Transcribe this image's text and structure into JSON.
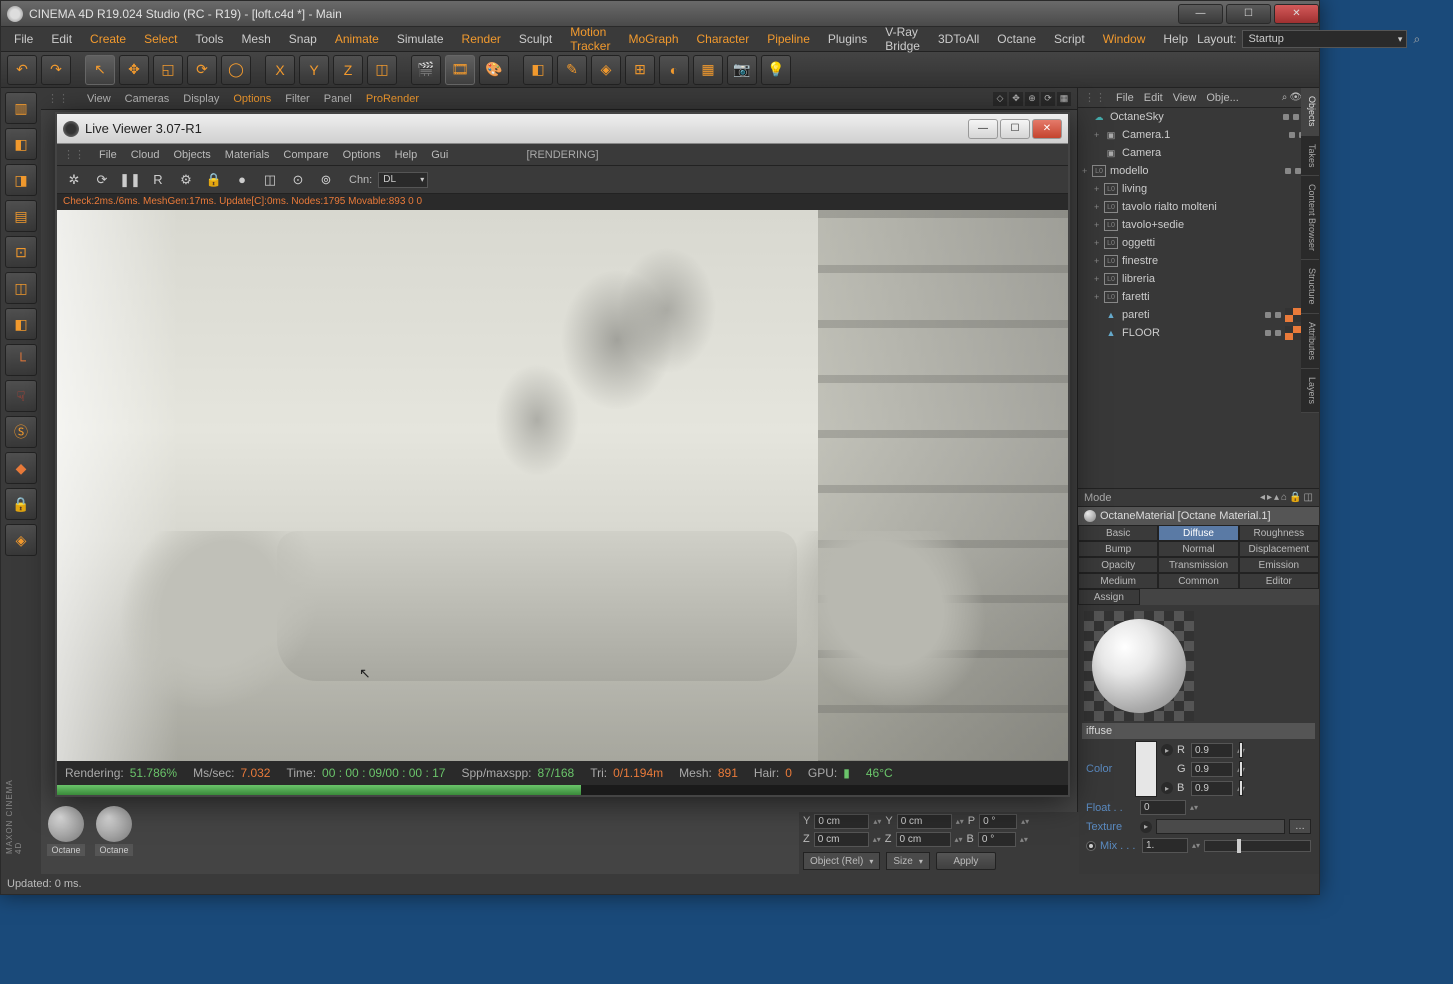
{
  "window": {
    "title": "CINEMA 4D R19.024 Studio (RC - R19) - [loft.c4d *] - Main"
  },
  "main_menu": [
    "File",
    "Edit",
    "Create",
    "Select",
    "Tools",
    "Mesh",
    "Snap",
    "Animate",
    "Simulate",
    "Render",
    "Sculpt",
    "Motion Tracker",
    "MoGraph",
    "Character",
    "Pipeline",
    "Plugins",
    "V-Ray Bridge",
    "3DToAll",
    "Octane",
    "Script",
    "Window",
    "Help"
  ],
  "layout": {
    "label": "Layout:",
    "value": "Startup"
  },
  "viewport_menu": [
    "View",
    "Cameras",
    "Display",
    "Options",
    "Filter",
    "Panel",
    "ProRender"
  ],
  "objects_panel": {
    "menu": [
      "File",
      "Edit",
      "View",
      "Obje..."
    ],
    "tree": [
      {
        "label": "OctaneSky",
        "icon": "sky",
        "tags": [
          "octane"
        ]
      },
      {
        "label": "Camera.1",
        "icon": "cam",
        "tags": [
          "rec"
        ],
        "indent": 1,
        "expand": "+"
      },
      {
        "label": "Camera",
        "icon": "cam",
        "tags": [],
        "indent": 1
      },
      {
        "label": "modello",
        "icon": "null",
        "tags": [
          "sphere"
        ],
        "expand": "+"
      },
      {
        "label": "living",
        "icon": "null",
        "tags": [],
        "indent": 1,
        "expand": "+"
      },
      {
        "label": "tavolo rialto molteni",
        "icon": "null",
        "tags": [],
        "indent": 1,
        "expand": "+"
      },
      {
        "label": "tavolo+sedie",
        "icon": "null",
        "tags": [],
        "indent": 1,
        "expand": "+"
      },
      {
        "label": "oggetti",
        "icon": "null",
        "tags": [],
        "indent": 1,
        "expand": "+"
      },
      {
        "label": "finestre",
        "icon": "null",
        "tags": [],
        "indent": 1,
        "expand": "+"
      },
      {
        "label": "libreria",
        "icon": "null",
        "tags": [],
        "indent": 1,
        "expand": "+"
      },
      {
        "label": "faretti",
        "icon": "null",
        "tags": [],
        "indent": 1,
        "expand": "+"
      },
      {
        "label": "pareti",
        "icon": "poly",
        "tags": [
          "checker",
          "checker"
        ],
        "indent": 1
      },
      {
        "label": "FLOOR",
        "icon": "poly",
        "tags": [
          "checker",
          "checker"
        ],
        "indent": 1
      }
    ]
  },
  "right_tabs": [
    "Objects",
    "Takes",
    "Content Browser",
    "Structure",
    "Attributes",
    "Layers"
  ],
  "attributes": {
    "mode_label": "Mode",
    "title": "OctaneMaterial [Octane Material.1]",
    "tabs_row1": [
      "Basic",
      "Diffuse",
      "Roughness"
    ],
    "tabs_row2": [
      "Bump",
      "Normal",
      "Displacement"
    ],
    "tabs_row3": [
      "Opacity",
      "Transmission",
      "Emission"
    ],
    "tabs_row4": [
      "Medium",
      "Common",
      "Editor"
    ],
    "tabs_row5": [
      "Assign"
    ],
    "active_tab": "Diffuse",
    "section": "iffuse",
    "color_label": "Color",
    "rgb": {
      "R": "0.9",
      "G": "0.9",
      "B": "0.9"
    },
    "float_label": "Float . .",
    "float_val": "0",
    "texture_label": "Texture",
    "mix_label": "Mix . . .",
    "mix_val": "1."
  },
  "coord": {
    "Y": "0 cm",
    "Y2": "0 cm",
    "P": "0 °",
    "Z": "0 cm",
    "Z2": "0 cm",
    "B": "0 °",
    "object_rel": "Object (Rel)",
    "size": "Size",
    "apply": "Apply"
  },
  "materials": [
    {
      "label": "Octane"
    },
    {
      "label": "Octane"
    }
  ],
  "status": "Updated: 0 ms.",
  "live_viewer": {
    "title": "Live Viewer 3.07-R1",
    "menu": [
      "File",
      "Cloud",
      "Objects",
      "Materials",
      "Compare",
      "Options",
      "Help",
      "Gui"
    ],
    "rendering_tag": "[RENDERING]",
    "chn_label": "Chn:",
    "chn_value": "DL",
    "stats": "Check:2ms./6ms. MeshGen:17ms. Update[C]:0ms. Nodes:1795 Movable:893  0 0",
    "status": {
      "rendering_lbl": "Rendering:",
      "rendering_val": "51.786%",
      "mssec_lbl": "Ms/sec:",
      "mssec_val": "7.032",
      "time_lbl": "Time:",
      "time_val": "00 : 00 : 09/00 : 00 : 17",
      "spp_lbl": "Spp/maxspp:",
      "spp_val": "87/168",
      "tri_lbl": "Tri:",
      "tri_val": "0/1.194m",
      "mesh_lbl": "Mesh:",
      "mesh_val": "891",
      "hair_lbl": "Hair:",
      "hair_val": "0",
      "gpu_lbl": "GPU:",
      "gpu_bar": "▮",
      "temp": "46°C"
    }
  }
}
